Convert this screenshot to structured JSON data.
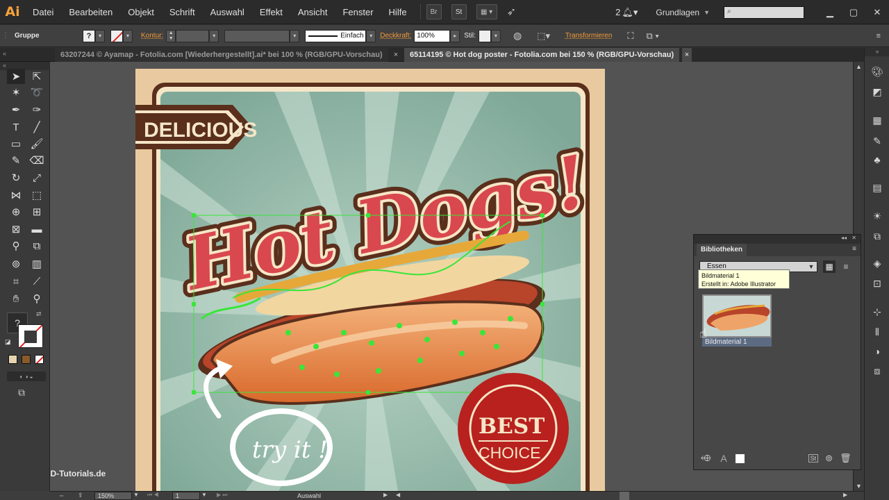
{
  "app": {
    "logo": "Ai",
    "workspace": "Grundlagen",
    "notification_count": "2"
  },
  "menu": [
    "Datei",
    "Bearbeiten",
    "Objekt",
    "Schrift",
    "Auswahl",
    "Effekt",
    "Ansicht",
    "Fenster",
    "Hilfe"
  ],
  "menubar_buttons": {
    "bridge": "Br",
    "stock": "St"
  },
  "controlbar": {
    "selection_type": "Gruppe",
    "stroke_label": "Kontur:",
    "stroke_style": "Einfach",
    "opacity_label": "Deckkraft:",
    "opacity_value": "100%",
    "style_label": "Stil:",
    "transform_label": "Transformieren"
  },
  "tabs": [
    {
      "title": "63207244 © Ayamap - Fotolia.com [Wiederhergestellt].ai* bei 100 % (RGB/GPU-Vorschau)",
      "close": "×",
      "active": false
    },
    {
      "title": "65114195 © Hot dog poster - Fotolia.com bei 150 % (RGB/GPU-Vorschau)",
      "close": "×",
      "active": true
    }
  ],
  "tools": {
    "fill_stroke_unknown": "?"
  },
  "artwork": {
    "banner_text": "DELICIOUS",
    "headline": "Hot Dogs!",
    "try_text": "try it !",
    "badge_line1": "BEST",
    "badge_line2": "CHOICE"
  },
  "libraries": {
    "panel_title": "Bibliotheken",
    "library_name": "Essen",
    "tooltip_line1": "Bildmaterial 1",
    "tooltip_line2": "Erstellt in: Adobe Illustrator",
    "item_label": "Bildmaterial 1"
  },
  "statusbar": {
    "zoom": "150%",
    "artboard_number": "1",
    "tool_name": "Auswahl"
  },
  "watermark": "PSD-Tutorials.de",
  "colors": {
    "accent_orange": "#f29b3a",
    "poster_teal": "#8fb6a5",
    "hotdog_red": "#c0392b",
    "selection_green": "#39e639",
    "badge_red": "#b8211e",
    "brown": "#5a2f1c"
  }
}
